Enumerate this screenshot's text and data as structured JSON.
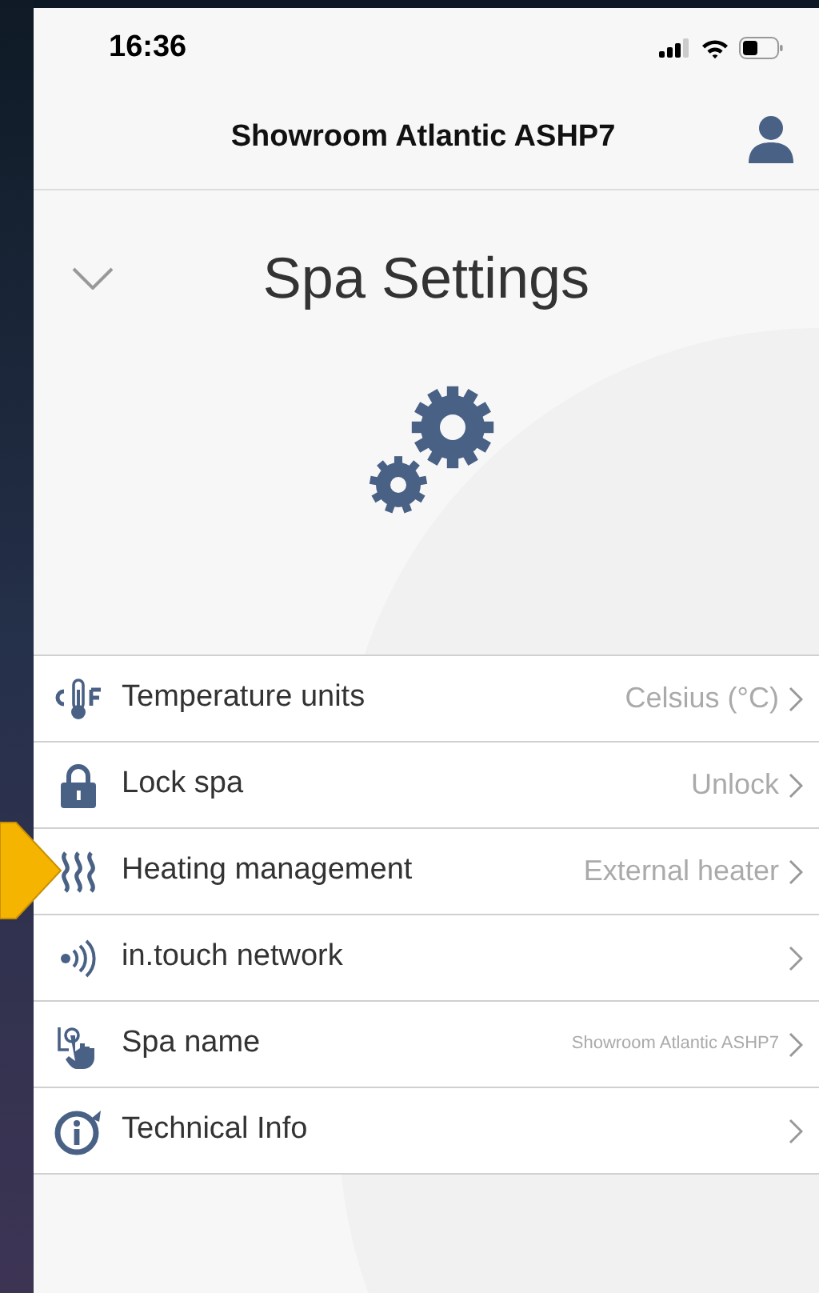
{
  "status_bar": {
    "time": "16:36"
  },
  "header": {
    "title": "Showroom Atlantic ASHP7"
  },
  "page": {
    "title": "Spa Settings"
  },
  "settings": [
    {
      "kind": "standard",
      "label": "Temperature units",
      "value": "Celsius (°C)"
    },
    {
      "kind": "standard",
      "label": "Lock spa",
      "value": "Unlock"
    },
    {
      "kind": "standard",
      "label": "Heating management",
      "value": "External heater"
    },
    {
      "label": "in.touch network"
    },
    {
      "kind": "compact",
      "label": "Spa name",
      "value": "Showroom Atlantic ASHP7"
    },
    {
      "label": "Technical Info"
    }
  ]
}
